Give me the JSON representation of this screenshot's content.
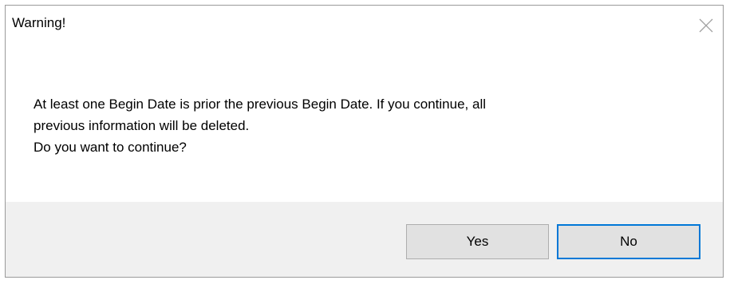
{
  "dialog": {
    "title": "Warning!",
    "close_icon": "close-icon",
    "message_lines": [
      "At least one Begin Date is prior the previous Begin Date.  If you continue, all",
      "previous information will be deleted.",
      "Do you want to continue?"
    ],
    "buttons": {
      "yes_label": "Yes",
      "no_label": "No"
    },
    "colors": {
      "default_button_border": "#0078d7",
      "button_face": "#e1e1e1",
      "footer_background": "#f0f0f0"
    }
  }
}
